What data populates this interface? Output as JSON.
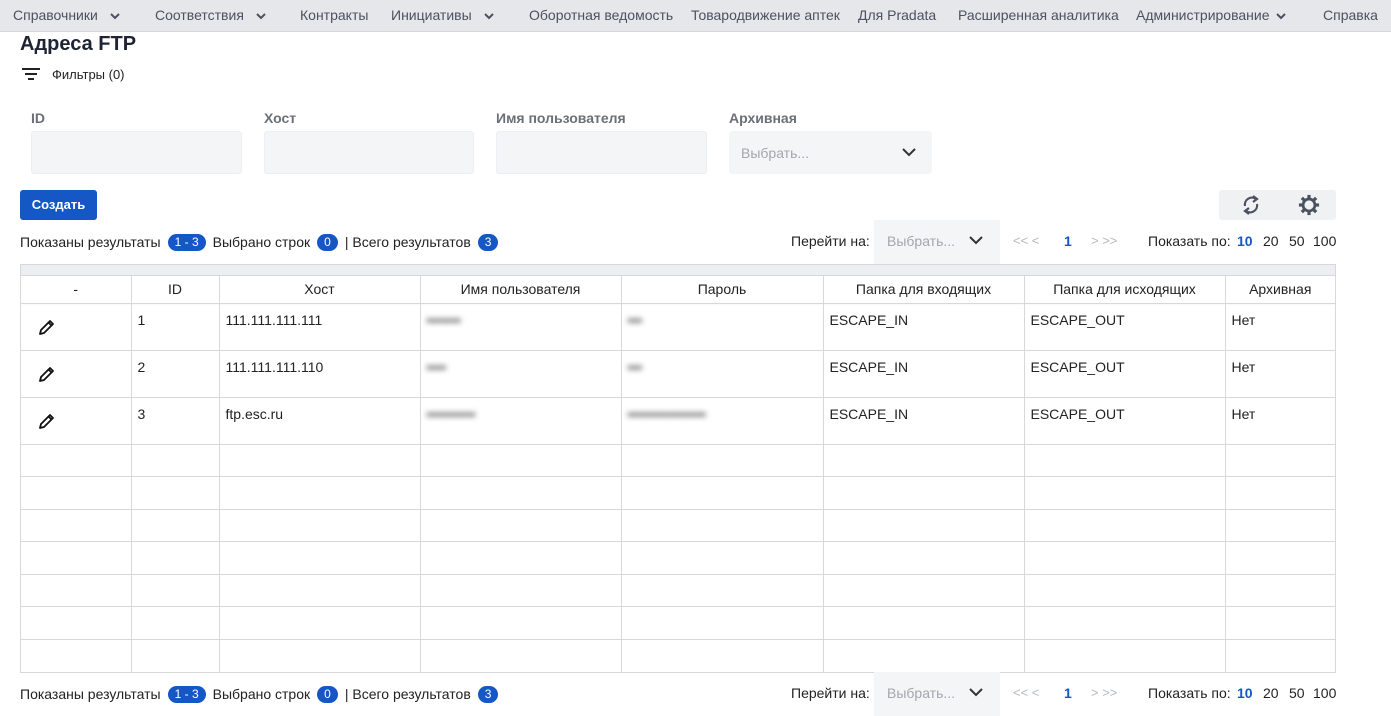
{
  "nav": {
    "items": [
      {
        "label": "Справочники",
        "has_dropdown": true
      },
      {
        "label": "Соответствия",
        "has_dropdown": true
      },
      {
        "label": "Контракты",
        "has_dropdown": false
      },
      {
        "label": "Инициативы",
        "has_dropdown": true
      },
      {
        "label": "Оборотная ведомость",
        "has_dropdown": false
      },
      {
        "label": "Товародвижение аптек",
        "has_dropdown": false
      },
      {
        "label": "Для Pradata",
        "has_dropdown": false
      },
      {
        "label": "Расширенная аналитика",
        "has_dropdown": false
      },
      {
        "label": "Администрирование",
        "has_dropdown": true
      },
      {
        "label": "Справка",
        "has_dropdown": false
      }
    ]
  },
  "page": {
    "title": "Адреса FTP",
    "filters_label": "Фильтры (0)"
  },
  "filters": {
    "id_label": "ID",
    "host_label": "Хост",
    "user_label": "Имя пользователя",
    "archive_label": "Архивная",
    "archive_placeholder": "Выбрать..."
  },
  "actions": {
    "create_label": "Создать",
    "refresh_icon": "refresh-icon",
    "settings_icon": "gear-icon"
  },
  "summary": {
    "shown_label": "Показаны результаты",
    "shown_range": "1 - 3",
    "selected_label": "Выбрано строк",
    "selected_count": "0",
    "total_label": "| Всего результатов",
    "total_count": "3"
  },
  "pager": {
    "goto_label": "Перейти на:",
    "goto_placeholder": "Выбрать...",
    "first_prev": "<<  <",
    "current_page": "1",
    "next_last": ">  >>",
    "page_size_label": "Показать по:",
    "page_sizes": [
      "10",
      "20",
      "50",
      "100"
    ],
    "active_page_size": "10"
  },
  "table": {
    "columns": [
      "-",
      "ID",
      "Хост",
      "Имя пользователя",
      "Пароль",
      "Папка для входящих",
      "Папка для исходящих",
      "Архивная"
    ],
    "rows": [
      {
        "id": "1",
        "host": "111.111.111.111",
        "user": "•••••••",
        "password": "•••",
        "incoming": "ESCAPE_IN",
        "outgoing": "ESCAPE_OUT",
        "archive": "Нет"
      },
      {
        "id": "2",
        "host": "111.111.111.110",
        "user": "••••",
        "password": "•••",
        "incoming": "ESCAPE_IN",
        "outgoing": "ESCAPE_OUT",
        "archive": "Нет"
      },
      {
        "id": "3",
        "host": "ftp.esc.ru",
        "user": "••••••••••",
        "password": "••••••••••••••••",
        "incoming": "ESCAPE_IN",
        "outgoing": "ESCAPE_OUT",
        "archive": "Нет"
      }
    ],
    "empty_row_count": 7
  },
  "colors": {
    "accent": "#1557c4",
    "nav_bg": "#e6e7ea",
    "input_bg": "#f4f5f7"
  }
}
